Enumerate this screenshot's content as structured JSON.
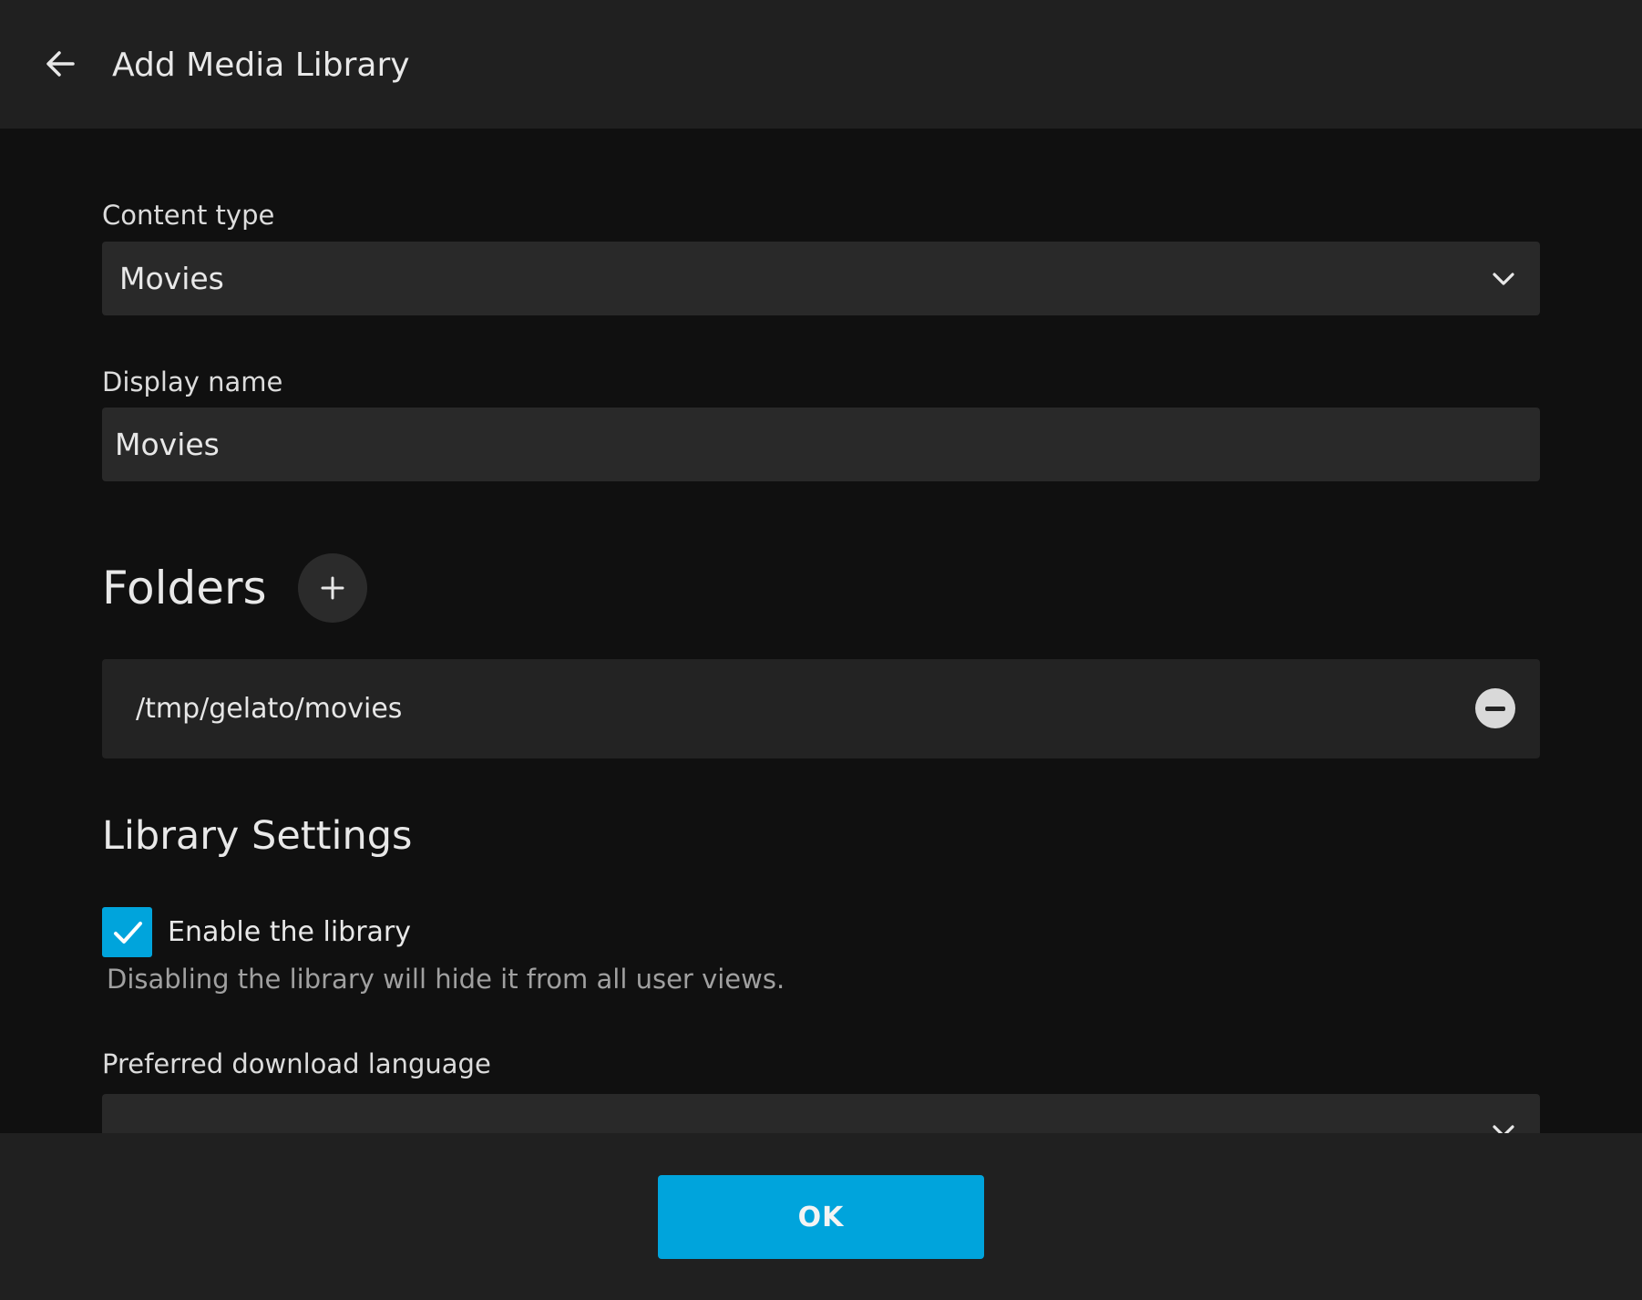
{
  "header": {
    "back_icon": "arrow-left-icon",
    "title": "Add Media Library"
  },
  "content_type": {
    "label": "Content type",
    "selected": "Movies",
    "icon": "chevron-down-icon"
  },
  "display_name": {
    "label": "Display name",
    "value": "Movies"
  },
  "folders": {
    "title": "Folders",
    "add_icon": "plus-icon",
    "items": [
      {
        "path": "/tmp/gelato/movies",
        "remove_icon": "minus-circle-icon"
      }
    ]
  },
  "library_settings": {
    "title": "Library Settings",
    "enable_library": {
      "label": "Enable the library",
      "checked": true,
      "helper": "Disabling the library will hide it from all user views."
    },
    "preferred_download_language": {
      "label": "Preferred download language",
      "selected": "",
      "icon": "chevron-down-icon"
    }
  },
  "footer": {
    "ok_label": "OK"
  },
  "colors": {
    "accent": "#00a4dc",
    "header_bg": "#202020",
    "page_bg": "#101010",
    "field_bg": "#292929"
  }
}
